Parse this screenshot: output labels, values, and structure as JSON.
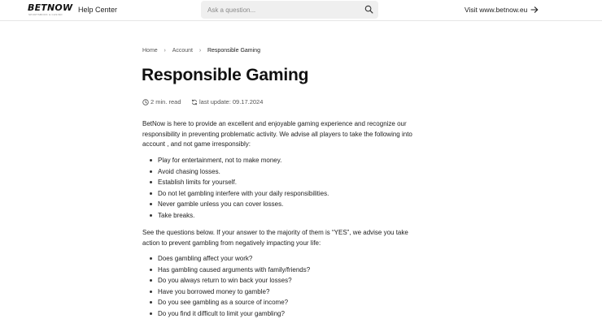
{
  "header": {
    "logo_text": "BETNOW",
    "logo_subtext": "SPORTSBOOK & CASINO",
    "help_center_label": "Help Center",
    "search_placeholder": "Ask a question...",
    "search_icon": "search-icon",
    "visit_label": "Visit www.betnow.eu",
    "visit_icon": "arrow-right-icon"
  },
  "breadcrumb": {
    "items": [
      "Home",
      "Account",
      "Responsible Gaming"
    ],
    "separator_icon": "chevron-right-icon"
  },
  "article": {
    "title": "Responsible Gaming",
    "read_time": "2 min. read",
    "read_time_icon": "clock-icon",
    "last_update": "last update: 09.17.2024",
    "last_update_icon": "refresh-icon",
    "intro": "BetNow is here to provide an excellent and enjoyable gaming experience and recognize our responsibility in preventing problematic activity. We advise all players to take the following into account , and not game irresponsibly:",
    "tips": [
      "Play for entertainment, not to make money.",
      "Avoid chasing losses.",
      "Establish limits for yourself.",
      "Do not let gambling interfere with your daily responsibilities.",
      "Never gamble unless you can cover losses.",
      "Take breaks."
    ],
    "questions_intro": "See the questions below. If your answer to the majority of them is “YES”, we advise you take action to prevent gambling from negatively impacting your life:",
    "questions": [
      "Does gambling affect your work?",
      "Has gambling caused arguments with family/friends?",
      "Do you always return to win back your losses?",
      "Have you borrowed money to gamble?",
      "Do you see gambling as a source of income?",
      "Do you find it difficult to limit your gambling?"
    ]
  },
  "colors": {
    "text": "#222222",
    "muted": "#555555",
    "search_bg": "#efefef",
    "divider": "#e6e6e6"
  }
}
